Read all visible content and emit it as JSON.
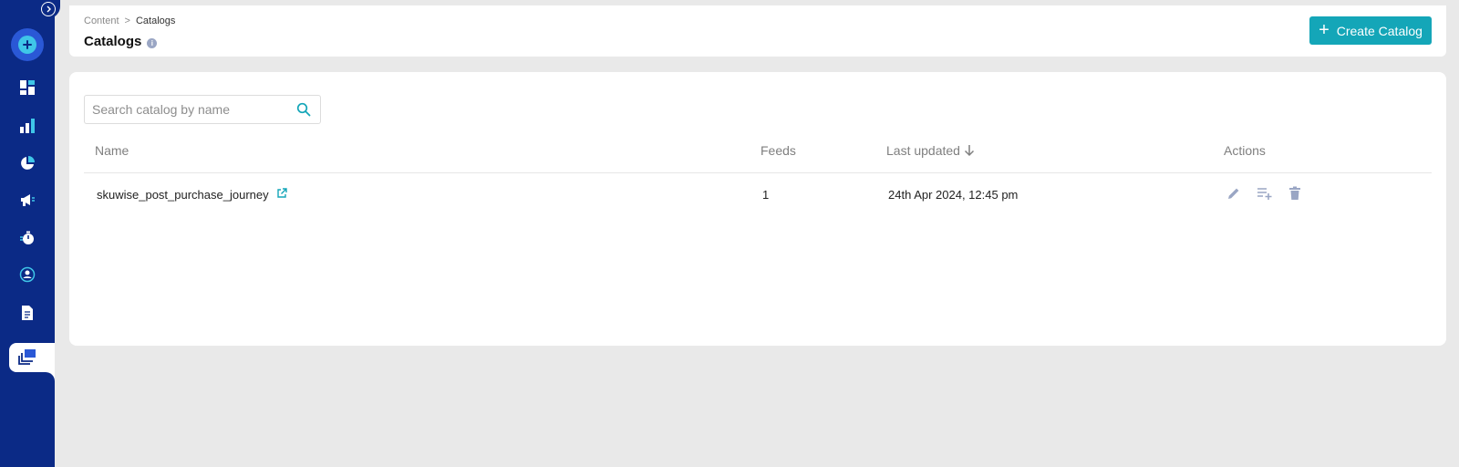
{
  "breadcrumb": {
    "parent": "Content",
    "separator": ">",
    "current": "Catalogs"
  },
  "header": {
    "title": "Catalogs",
    "create_label": "Create Catalog",
    "create_icon": "plus-icon"
  },
  "search": {
    "placeholder": "Search catalog by name",
    "value": ""
  },
  "table": {
    "columns": [
      "Name",
      "Feeds",
      "Last updated",
      "Actions"
    ],
    "sort_column": "Last updated",
    "sort_direction": "desc",
    "rows": [
      {
        "name": "skuwise_post_purchase_journey",
        "feeds": "1",
        "last_updated": "24th Apr 2024, 12:45 pm"
      }
    ]
  },
  "sidebar": {
    "items": [
      "dashboard-icon",
      "analytics-icon",
      "pie-chart-icon",
      "megaphone-icon",
      "timer-icon",
      "audience-icon",
      "document-icon",
      "catalog-icon"
    ],
    "active": "catalog-icon"
  },
  "colors": {
    "sidebar": "#0b2a86",
    "accent": "#14a6b8",
    "icon_grey": "#9aa6c4"
  }
}
